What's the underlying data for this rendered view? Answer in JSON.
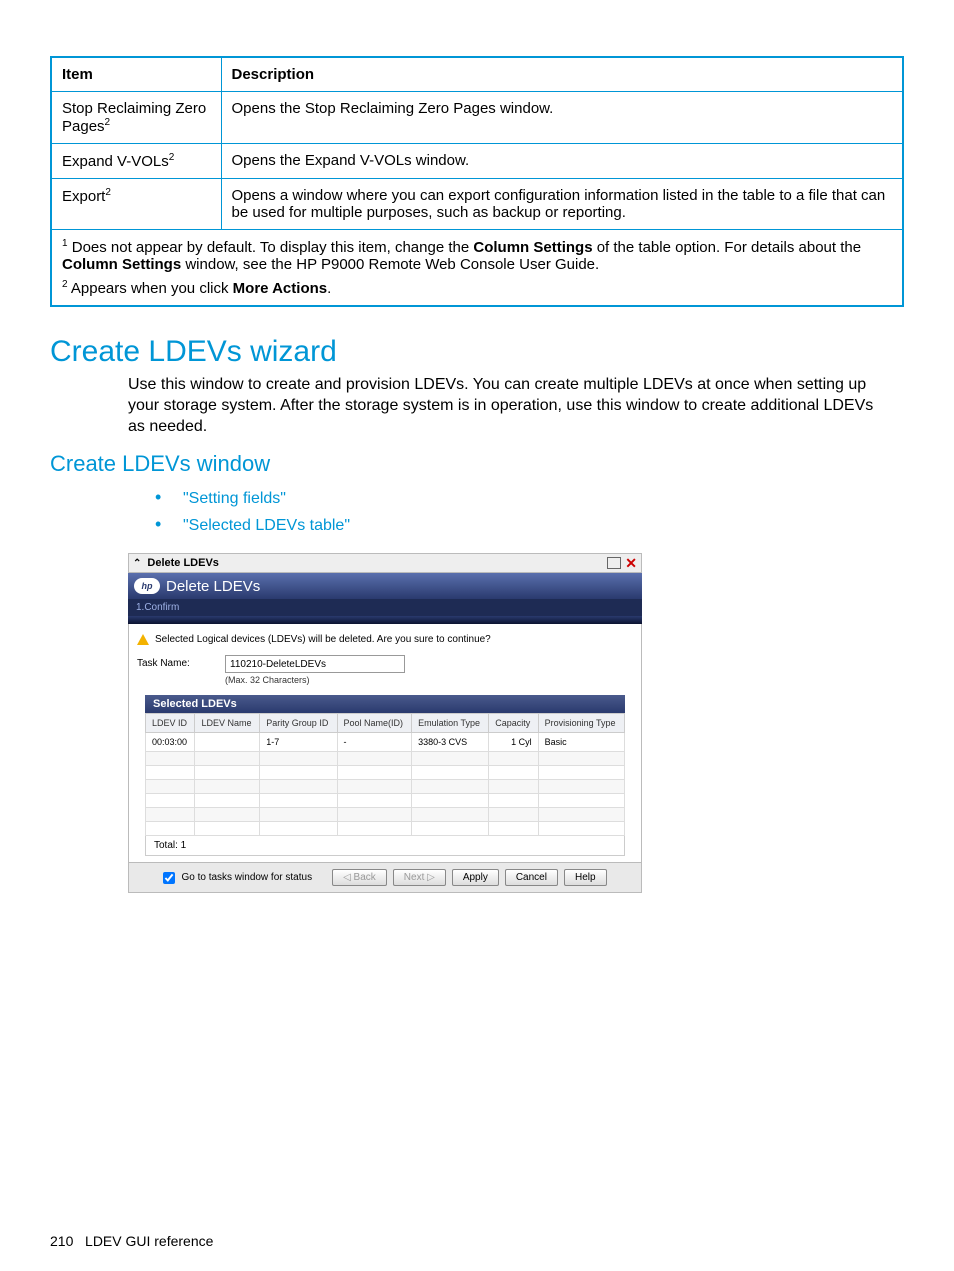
{
  "table": {
    "headers": [
      "Item",
      "Description"
    ],
    "rows": [
      {
        "item": "Stop Reclaiming Zero Pages",
        "sup": "2",
        "desc": "Opens the Stop Reclaiming Zero Pages window."
      },
      {
        "item": "Expand V-VOLs",
        "sup": "2",
        "desc": "Opens the Expand V-VOLs window."
      },
      {
        "item": "Export",
        "sup": "2",
        "desc": "Opens a window where you can export configuration information listed in the table to a file that can be used for multiple purposes, such as backup or reporting."
      }
    ],
    "footnote1_pre": " Does not appear by default. To display this item, change the ",
    "footnote1_bold1": "Column Settings",
    "footnote1_mid": " of the table option. For details about the ",
    "footnote1_bold2": "Column Settings",
    "footnote1_post": " window, see the HP P9000 Remote Web Console User Guide.",
    "footnote2_pre": " Appears when you click ",
    "footnote2_bold": "More Actions",
    "footnote2_post": "."
  },
  "section_h1": "Create LDEVs wizard",
  "section_p": "Use this window to create and provision LDEVs. You can create multiple LDEVs at once when setting up your storage system. After the storage system is in operation, use this window to create additional LDEVs as needed.",
  "subsection_h2": "Create LDEVs window",
  "links": [
    "\"Setting fields\"",
    "\"Selected LDEVs table\""
  ],
  "dialog": {
    "titlebar": "Delete LDEVs",
    "header": "Delete LDEVs",
    "logo": "hp",
    "step": "1.Confirm",
    "warning": "Selected Logical devices (LDEVs) will be deleted. Are you sure to continue?",
    "task_label": "Task Name:",
    "task_value": "110210-DeleteLDEVs",
    "task_hint": "(Max. 32 Characters)",
    "selected_title": "Selected LDEVs",
    "grid_headers": [
      "LDEV ID",
      "LDEV Name",
      "Parity Group ID",
      "Pool Name(ID)",
      "Emulation Type",
      "Capacity",
      "Provisioning Type"
    ],
    "grid_rows": [
      [
        "00:03:00",
        "",
        "1-7",
        "-",
        "3380-3 CVS",
        "1 Cyl",
        "Basic"
      ]
    ],
    "total": "Total:  1",
    "footer": {
      "checkbox_label": "Go to tasks window for status",
      "back": "◁ Back",
      "next": "Next ▷",
      "apply": "Apply",
      "cancel": "Cancel",
      "help": "Help"
    }
  },
  "page_footer": {
    "num": "210",
    "label": "LDEV GUI reference"
  }
}
